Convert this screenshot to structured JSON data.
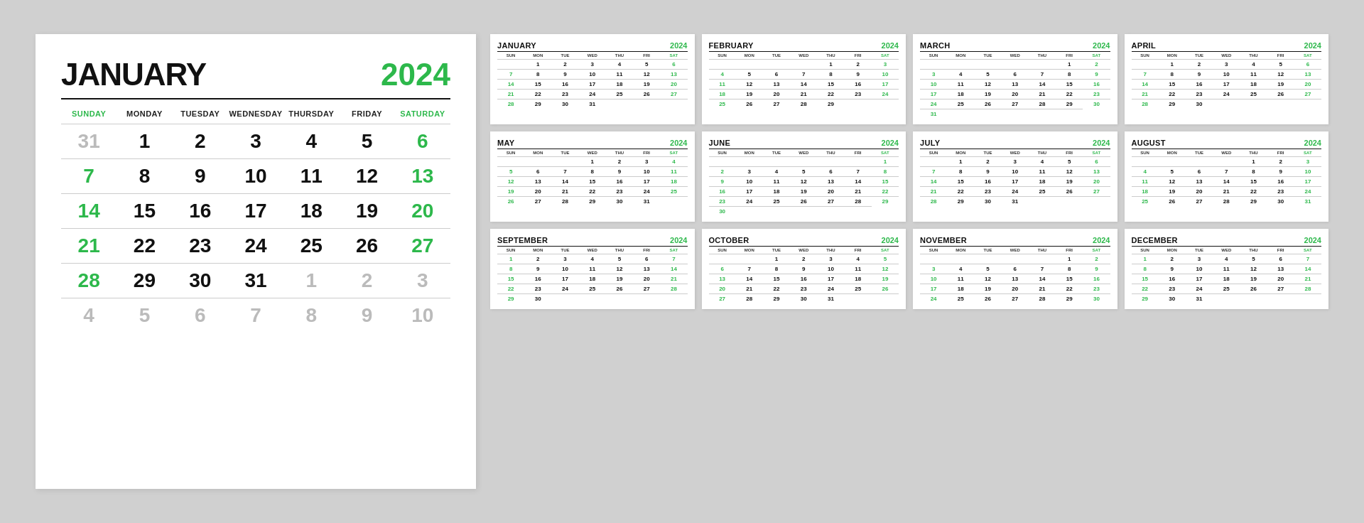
{
  "year": "2024",
  "accent_color": "#2db84b",
  "large_calendar": {
    "month": "JANUARY",
    "year": "2024",
    "days_of_week": [
      "SUNDAY",
      "MONDAY",
      "TUESDAY",
      "WEDNESDAY",
      "THURSDAY",
      "FRIDAY",
      "SATURDAY"
    ],
    "weeks": [
      [
        "31",
        "1",
        "2",
        "3",
        "4",
        "5",
        "6"
      ],
      [
        "7",
        "8",
        "9",
        "10",
        "11",
        "12",
        "13"
      ],
      [
        "14",
        "15",
        "16",
        "17",
        "18",
        "19",
        "20"
      ],
      [
        "21",
        "22",
        "23",
        "24",
        "25",
        "26",
        "27"
      ],
      [
        "28",
        "29",
        "30",
        "31",
        "1",
        "2",
        "3"
      ],
      [
        "4",
        "5",
        "6",
        "7",
        "8",
        "9",
        "10"
      ]
    ],
    "other_month_days_start": [
      "31"
    ],
    "other_month_days_end": [
      "1",
      "2",
      "3",
      "4",
      "5",
      "6",
      "7",
      "8",
      "9",
      "10"
    ]
  },
  "small_calendars": [
    {
      "month": "JANUARY",
      "year": "2024",
      "weeks": [
        [
          "",
          "1",
          "2",
          "3",
          "4",
          "5",
          "6"
        ],
        [
          "7",
          "8",
          "9",
          "10",
          "11",
          "12",
          "13"
        ],
        [
          "14",
          "15",
          "16",
          "17",
          "18",
          "19",
          "20"
        ],
        [
          "21",
          "22",
          "23",
          "24",
          "25",
          "26",
          "27"
        ],
        [
          "28",
          "29",
          "30",
          "31",
          "",
          "",
          ""
        ]
      ]
    },
    {
      "month": "FEBRUARY",
      "year": "2024",
      "weeks": [
        [
          "",
          "",
          "",
          "",
          "1",
          "2",
          "3"
        ],
        [
          "4",
          "5",
          "6",
          "7",
          "8",
          "9",
          "10"
        ],
        [
          "11",
          "12",
          "13",
          "14",
          "15",
          "16",
          "17"
        ],
        [
          "18",
          "19",
          "20",
          "21",
          "22",
          "23",
          "24"
        ],
        [
          "25",
          "26",
          "27",
          "28",
          "29",
          "",
          ""
        ]
      ]
    },
    {
      "month": "MARCH",
      "year": "2024",
      "weeks": [
        [
          "",
          "",
          "",
          "",
          "",
          "1",
          "2"
        ],
        [
          "3",
          "4",
          "5",
          "6",
          "7",
          "8",
          "9"
        ],
        [
          "10",
          "11",
          "12",
          "13",
          "14",
          "15",
          "16"
        ],
        [
          "17",
          "18",
          "19",
          "20",
          "21",
          "22",
          "23"
        ],
        [
          "24",
          "25",
          "26",
          "27",
          "28",
          "29",
          "30"
        ],
        [
          "31",
          "",
          "",
          "",
          "",
          "",
          ""
        ]
      ]
    },
    {
      "month": "APRIL",
      "year": "2024",
      "weeks": [
        [
          "",
          "1",
          "2",
          "3",
          "4",
          "5",
          "6"
        ],
        [
          "7",
          "8",
          "9",
          "10",
          "11",
          "12",
          "13"
        ],
        [
          "14",
          "15",
          "16",
          "17",
          "18",
          "19",
          "20"
        ],
        [
          "21",
          "22",
          "23",
          "24",
          "25",
          "26",
          "27"
        ],
        [
          "28",
          "29",
          "30",
          "",
          "",
          "",
          ""
        ]
      ]
    },
    {
      "month": "MAY",
      "year": "2024",
      "weeks": [
        [
          "",
          "",
          "",
          "1",
          "2",
          "3",
          "4"
        ],
        [
          "5",
          "6",
          "7",
          "8",
          "9",
          "10",
          "11"
        ],
        [
          "12",
          "13",
          "14",
          "15",
          "16",
          "17",
          "18"
        ],
        [
          "19",
          "20",
          "21",
          "22",
          "23",
          "24",
          "25"
        ],
        [
          "26",
          "27",
          "28",
          "29",
          "30",
          "31",
          ""
        ]
      ]
    },
    {
      "month": "JUNE",
      "year": "2024",
      "weeks": [
        [
          "",
          "",
          "",
          "",
          "",
          "",
          "1"
        ],
        [
          "2",
          "3",
          "4",
          "5",
          "6",
          "7",
          "8"
        ],
        [
          "9",
          "10",
          "11",
          "12",
          "13",
          "14",
          "15"
        ],
        [
          "16",
          "17",
          "18",
          "19",
          "20",
          "21",
          "22"
        ],
        [
          "23",
          "24",
          "25",
          "26",
          "27",
          "28",
          "29"
        ],
        [
          "30",
          "",
          "",
          "",
          "",
          "",
          ""
        ]
      ]
    },
    {
      "month": "JULY",
      "year": "2024",
      "weeks": [
        [
          "",
          "1",
          "2",
          "3",
          "4",
          "5",
          "6"
        ],
        [
          "7",
          "8",
          "9",
          "10",
          "11",
          "12",
          "13"
        ],
        [
          "14",
          "15",
          "16",
          "17",
          "18",
          "19",
          "20"
        ],
        [
          "21",
          "22",
          "23",
          "24",
          "25",
          "26",
          "27"
        ],
        [
          "28",
          "29",
          "30",
          "31",
          "",
          "",
          ""
        ]
      ]
    },
    {
      "month": "AUGUST",
      "year": "2024",
      "weeks": [
        [
          "",
          "",
          "",
          "",
          "1",
          "2",
          "3"
        ],
        [
          "4",
          "5",
          "6",
          "7",
          "8",
          "9",
          "10"
        ],
        [
          "11",
          "12",
          "13",
          "14",
          "15",
          "16",
          "17"
        ],
        [
          "18",
          "19",
          "20",
          "21",
          "22",
          "23",
          "24"
        ],
        [
          "25",
          "26",
          "27",
          "28",
          "29",
          "30",
          "31"
        ]
      ]
    },
    {
      "month": "SEPTEMBER",
      "year": "2024",
      "weeks": [
        [
          "1",
          "2",
          "3",
          "4",
          "5",
          "6",
          "7"
        ],
        [
          "8",
          "9",
          "10",
          "11",
          "12",
          "13",
          "14"
        ],
        [
          "15",
          "16",
          "17",
          "18",
          "19",
          "20",
          "21"
        ],
        [
          "22",
          "23",
          "24",
          "25",
          "26",
          "27",
          "28"
        ],
        [
          "29",
          "30",
          "",
          "",
          "",
          "",
          ""
        ]
      ]
    },
    {
      "month": "OCTOBER",
      "year": "2024",
      "weeks": [
        [
          "",
          "",
          "1",
          "2",
          "3",
          "4",
          "5"
        ],
        [
          "6",
          "7",
          "8",
          "9",
          "10",
          "11",
          "12"
        ],
        [
          "13",
          "14",
          "15",
          "16",
          "17",
          "18",
          "19"
        ],
        [
          "20",
          "21",
          "22",
          "23",
          "24",
          "25",
          "26"
        ],
        [
          "27",
          "28",
          "29",
          "30",
          "31",
          "",
          ""
        ]
      ]
    },
    {
      "month": "NOVEMBER",
      "year": "2024",
      "weeks": [
        [
          "",
          "",
          "",
          "",
          "",
          "1",
          "2"
        ],
        [
          "3",
          "4",
          "5",
          "6",
          "7",
          "8",
          "9"
        ],
        [
          "10",
          "11",
          "12",
          "13",
          "14",
          "15",
          "16"
        ],
        [
          "17",
          "18",
          "19",
          "20",
          "21",
          "22",
          "23"
        ],
        [
          "24",
          "25",
          "26",
          "27",
          "28",
          "29",
          "30"
        ]
      ]
    },
    {
      "month": "DECEMBER",
      "year": "2024",
      "weeks": [
        [
          "1",
          "2",
          "3",
          "4",
          "5",
          "6",
          "7"
        ],
        [
          "8",
          "9",
          "10",
          "11",
          "12",
          "13",
          "14"
        ],
        [
          "15",
          "16",
          "17",
          "18",
          "19",
          "20",
          "21"
        ],
        [
          "22",
          "23",
          "24",
          "25",
          "26",
          "27",
          "28"
        ],
        [
          "29",
          "30",
          "31",
          "",
          "",
          "",
          ""
        ]
      ]
    }
  ],
  "days_of_week_short": [
    "SUN",
    "MON",
    "TUE",
    "WED",
    "THU",
    "FRI",
    "SAT"
  ]
}
